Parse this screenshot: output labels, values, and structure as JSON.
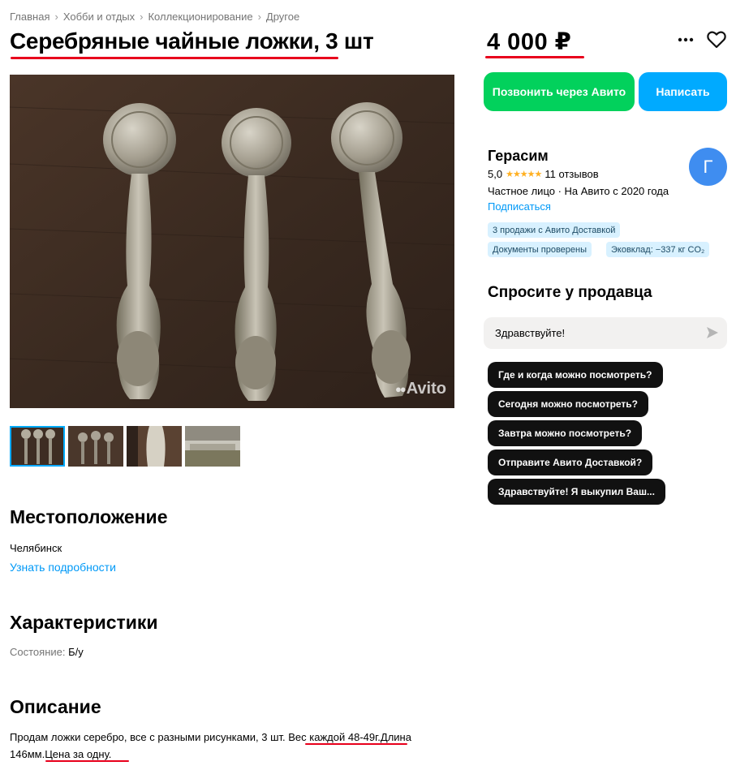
{
  "breadcrumbs": [
    "Главная",
    "Хобби и отдых",
    "Коллекционирование",
    "Другое"
  ],
  "breadcrumb_separator": "›",
  "title": "Серебряные чайные ложки, 3 шт",
  "price": "4 000 ₽",
  "actions": {
    "more_icon": "more-dots-icon",
    "favorite_icon": "heart-icon"
  },
  "gallery": {
    "watermark": "Avito",
    "thumbnails": 4,
    "active_thumbnail": 1
  },
  "buttons": {
    "call": "Позвонить через Авито",
    "write": "Написать"
  },
  "seller": {
    "name": "Герасим",
    "rating": "5,0",
    "stars": "★★★★★",
    "reviews": "11 отзывов",
    "type": "Частное лицо · На Авито с 2020 года",
    "subscribe": "Подписаться",
    "avatar_letter": "Г",
    "badges": [
      "3 продажи с Авито Доставкой",
      "Документы проверены",
      "Эковклад: −337 кг CO₂"
    ]
  },
  "ask": {
    "title": "Спросите у продавца",
    "input_value": "Здравствуйте!",
    "quick_questions": [
      "Где и когда можно посмотреть?",
      "Сегодня можно посмотреть?",
      "Завтра можно посмотреть?",
      "Отправите Авито Доставкой?",
      "Здравствуйте! Я выкупил Ваш..."
    ]
  },
  "location": {
    "heading": "Местоположение",
    "city": "Челябинск",
    "details_link": "Узнать подробности"
  },
  "characteristics": {
    "heading": "Характеристики",
    "condition_label": "Состояние:",
    "condition_value": "Б/у"
  },
  "description": {
    "heading": "Описание",
    "part1": "Продам ложки серебро, все с разными рисунками, 3 шт. ",
    "part2": "Вес каждой 48-49г.",
    "part3": "Длина 146мм.",
    "part4": "Цена за одну."
  },
  "colors": {
    "accent_blue": "#00aaff",
    "call_green": "#02d15c",
    "underline_red": "#e8001c",
    "link": "#0099f7"
  }
}
